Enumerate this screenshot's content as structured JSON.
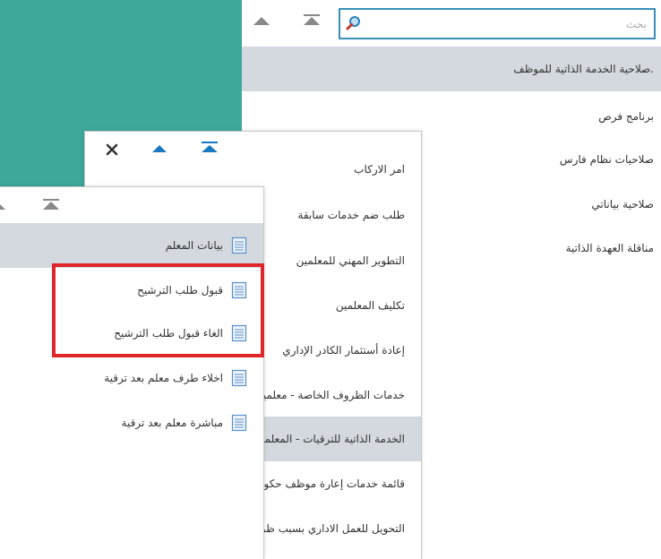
{
  "search": {
    "placeholder": "بحث"
  },
  "panel1": {
    "items": [
      {
        "label": ".صلاحية الخدمة الذاتية للموظف",
        "selected": true
      },
      {
        "label": "برنامج فرص"
      },
      {
        "label": "صلاحيات نظام فارس"
      },
      {
        "label": "صلاحية بياناتي"
      },
      {
        "label": "مناقلة العهدة الذاتية"
      }
    ]
  },
  "panel2": {
    "items": [
      {
        "label": "امر الاركاب"
      },
      {
        "label": "طلب ضم خدمات سابقة"
      },
      {
        "label": "التطوير المهني للمعلمين"
      },
      {
        "label": "تكليف المعلمين"
      },
      {
        "label": "إعادة أستثمار الكادر الإداري"
      },
      {
        "label": "خدمات الظروف الخاصة - معلمين"
      },
      {
        "label": "الخدمة الذاتية للترقيات - المعلمين",
        "selected": true
      },
      {
        "label": "قائمة خدمات إعارة موظف حكومي"
      },
      {
        "label": "التحويل للعمل الاداري بسبب ظروف صحية"
      }
    ]
  },
  "panel3": {
    "items": [
      {
        "label": "بيانات المعلم",
        "selected": true,
        "icon": "document-icon"
      },
      {
        "label": "قبول طلب الترشيح",
        "icon": "document-icon"
      },
      {
        "label": "الغاء قبول طلب الترشيح",
        "icon": "document-icon"
      },
      {
        "label": "اخلاء طرف معلم بعد ترقية",
        "icon": "document-icon"
      },
      {
        "label": "مباشرة معلم بعد ترقية",
        "icon": "document-icon"
      }
    ]
  },
  "colors": {
    "accent": "#1a78c2",
    "teal": "#3ea89a",
    "highlight_box": "#e0262b",
    "selected_row": "#d3d9de",
    "icon_gray": "#888888"
  }
}
